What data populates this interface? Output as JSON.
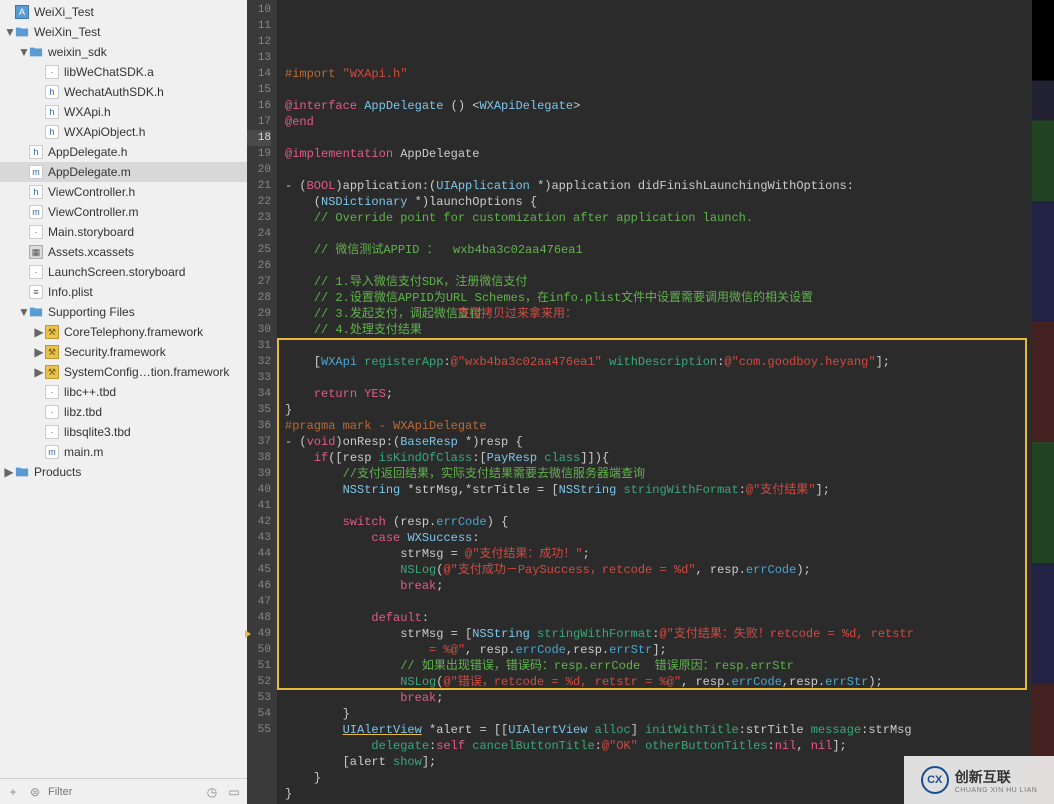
{
  "sidebar": {
    "tree": [
      {
        "level": 0,
        "disc": "",
        "icon": "app",
        "label": "WeiXi_Test"
      },
      {
        "level": 0,
        "disc": "▼",
        "icon": "folder",
        "label": "WeiXin_Test"
      },
      {
        "level": 1,
        "disc": "▼",
        "icon": "folder",
        "label": "weixin_sdk"
      },
      {
        "level": 2,
        "disc": "",
        "icon": "generic",
        "label": "libWeChatSDK.a"
      },
      {
        "level": 2,
        "disc": "",
        "icon": "h",
        "label": "WechatAuthSDK.h"
      },
      {
        "level": 2,
        "disc": "",
        "icon": "h",
        "label": "WXApi.h"
      },
      {
        "level": 2,
        "disc": "",
        "icon": "h",
        "label": "WXApiObject.h"
      },
      {
        "level": 1,
        "disc": "",
        "icon": "h",
        "label": "AppDelegate.h"
      },
      {
        "level": 1,
        "disc": "",
        "icon": "m",
        "label": "AppDelegate.m",
        "selected": true
      },
      {
        "level": 1,
        "disc": "",
        "icon": "h",
        "label": "ViewController.h"
      },
      {
        "level": 1,
        "disc": "",
        "icon": "m",
        "label": "ViewController.m"
      },
      {
        "level": 1,
        "disc": "",
        "icon": "generic",
        "label": "Main.storyboard"
      },
      {
        "level": 1,
        "disc": "",
        "icon": "xcassets",
        "label": "Assets.xcassets"
      },
      {
        "level": 1,
        "disc": "",
        "icon": "generic",
        "label": "LaunchScreen.storyboard"
      },
      {
        "level": 1,
        "disc": "",
        "icon": "plist",
        "label": "Info.plist"
      },
      {
        "level": 1,
        "disc": "▼",
        "icon": "folder",
        "label": "Supporting Files"
      },
      {
        "level": 2,
        "disc": "▶",
        "icon": "framework",
        "label": "CoreTelephony.framework"
      },
      {
        "level": 2,
        "disc": "▶",
        "icon": "framework",
        "label": "Security.framework"
      },
      {
        "level": 2,
        "disc": "▶",
        "icon": "framework",
        "label": "SystemConfig…tion.framework"
      },
      {
        "level": 2,
        "disc": "",
        "icon": "generic",
        "label": "libc++.tbd"
      },
      {
        "level": 2,
        "disc": "",
        "icon": "generic",
        "label": "libz.tbd"
      },
      {
        "level": 2,
        "disc": "",
        "icon": "generic",
        "label": "libsqlite3.tbd"
      },
      {
        "level": 2,
        "disc": "",
        "icon": "m",
        "label": "main.m"
      },
      {
        "level": 0,
        "disc": "▶",
        "icon": "folder",
        "label": "Products"
      }
    ]
  },
  "filter": {
    "placeholder": "Filter"
  },
  "code_lines": {
    "first_ln": 10,
    "current_ln": 18,
    "warn_ln": 49,
    "raw": [
      "<span class='dir'>#import</span> <span class='str'>\"WXApi.h\"</span>",
      "",
      "<span class='kw'>@interface</span> <span class='type'>AppDelegate</span> () &lt;<span class='type'>WXApiDelegate</span>&gt;",
      "<span class='kw'>@end</span>",
      "",
      "<span class='kw'>@implementation</span> AppDelegate",
      "",
      "- (<span class='kw'>BOOL</span>)application:(<span class='type'>UIApplication</span> *)application didFinishLaunchingWithOptions:",
      "    (<span class='type'>NSDictionary</span> *)launchOptions {",
      "    <span class='cmt'>// Override point for customization after application launch.</span>",
      "",
      "    <span class='cmt'>// 微信测试APPID ：  wxb4ba3c02aa476ea1</span>",
      "",
      "    <span class='cmt'>// 1.导入微信支付SDK，注册微信支付</span>",
      "    <span class='cmt'>// 2.设置微信APPID为URL Schemes，在info.plist文件中设置需要调用微信的相关设置</span>",
      "    <span class='cmt'>// 3.发起支付，调起微信支付</span>",
      "    <span class='cmt'>// 4.处理支付结果</span>",
      "",
      "    [<span class='type2'>WXApi</span> <span class='msg'>registerApp</span>:<span class='str'>@\"wxb4ba3c02aa476ea1\"</span> <span class='msg'>withDescription</span>:<span class='str'>@\"com.goodboy.heyang\"</span>];",
      "",
      "    <span class='kw'>return</span> <span class='kw'>YES</span>;",
      "}",
      "<span class='dir'>#pragma mark - WXApiDelegate</span>",
      "- (<span class='kw'>void</span>)onResp:(<span class='type'>BaseResp</span> *)resp {",
      "    <span class='kw'>if</span>([resp <span class='msg'>isKindOfClass</span>:[<span class='type'>PayResp</span> <span class='msg'>class</span>]]){",
      "        <span class='cmt'>//支付返回结果，实际支付结果需要去微信服务器端查询</span>",
      "        <span class='type'>NSString</span> *strMsg,*strTitle = [<span class='type'>NSString</span> <span class='msg'>stringWithFormat</span>:<span class='str'>@\"支付结果\"</span>];",
      "",
      "        <span class='kw'>switch</span> (resp.<span class='type2'>errCode</span>) {",
      "            <span class='kw'>case</span> <span class='type'>WXSuccess</span>:",
      "                strMsg = <span class='str'>@\"支付结果：成功！\"</span>;",
      "                <span class='fn'>NSLog</span>(<span class='str'>@\"支付成功－PaySuccess，retcode = %d\"</span>, resp.<span class='type2'>errCode</span>);",
      "                <span class='kw'>break</span>;",
      "",
      "            <span class='kw'>default</span>:",
      "                strMsg = [<span class='type'>NSString</span> <span class='msg'>stringWithFormat</span>:<span class='str'>@\"支付结果：失败！retcode = %d, retstr</span>",
      "                    <span class='str'>= %@\"</span>, resp.<span class='type2'>errCode</span>,resp.<span class='type2'>errStr</span>];",
      "                <span class='cmt'>// 如果出现错误，错误码：resp.errCode  错误原因：resp.errStr</span>",
      "                <span class='fn'>NSLog</span>(<span class='str'>@\"错误，retcode = %d, retstr = %@\"</span>, resp.<span class='type2'>errCode</span>,resp.<span class='type2'>errStr</span>);",
      "                <span class='kw'>break</span>;",
      "        }",
      "        <span class='type warn-fn'>UIAlertView</span> *alert = [[<span class='type'>UIAlertView</span> <span class='msg'>alloc</span>] <span class='msg'>initWithTitle</span>:strTitle <span class='msg'>message</span>:strMsg",
      "            <span class='msg'>delegate</span>:<span class='kw'>self</span> <span class='msg'>cancelButtonTitle</span>:<span class='str'>@\"OK\"</span> <span class='msg'>otherButtonTitles</span>:<span class='kw'>nil</span>, <span class='kw'>nil</span>];",
      "        [alert <span class='msg'>show</span>];",
      "    }",
      "}"
    ]
  },
  "annotation": "直接拷贝过来拿来用：",
  "watermark": {
    "logo": "CX",
    "text1": "创新互联",
    "text2": "CHUANG XIN HU LIAN"
  }
}
